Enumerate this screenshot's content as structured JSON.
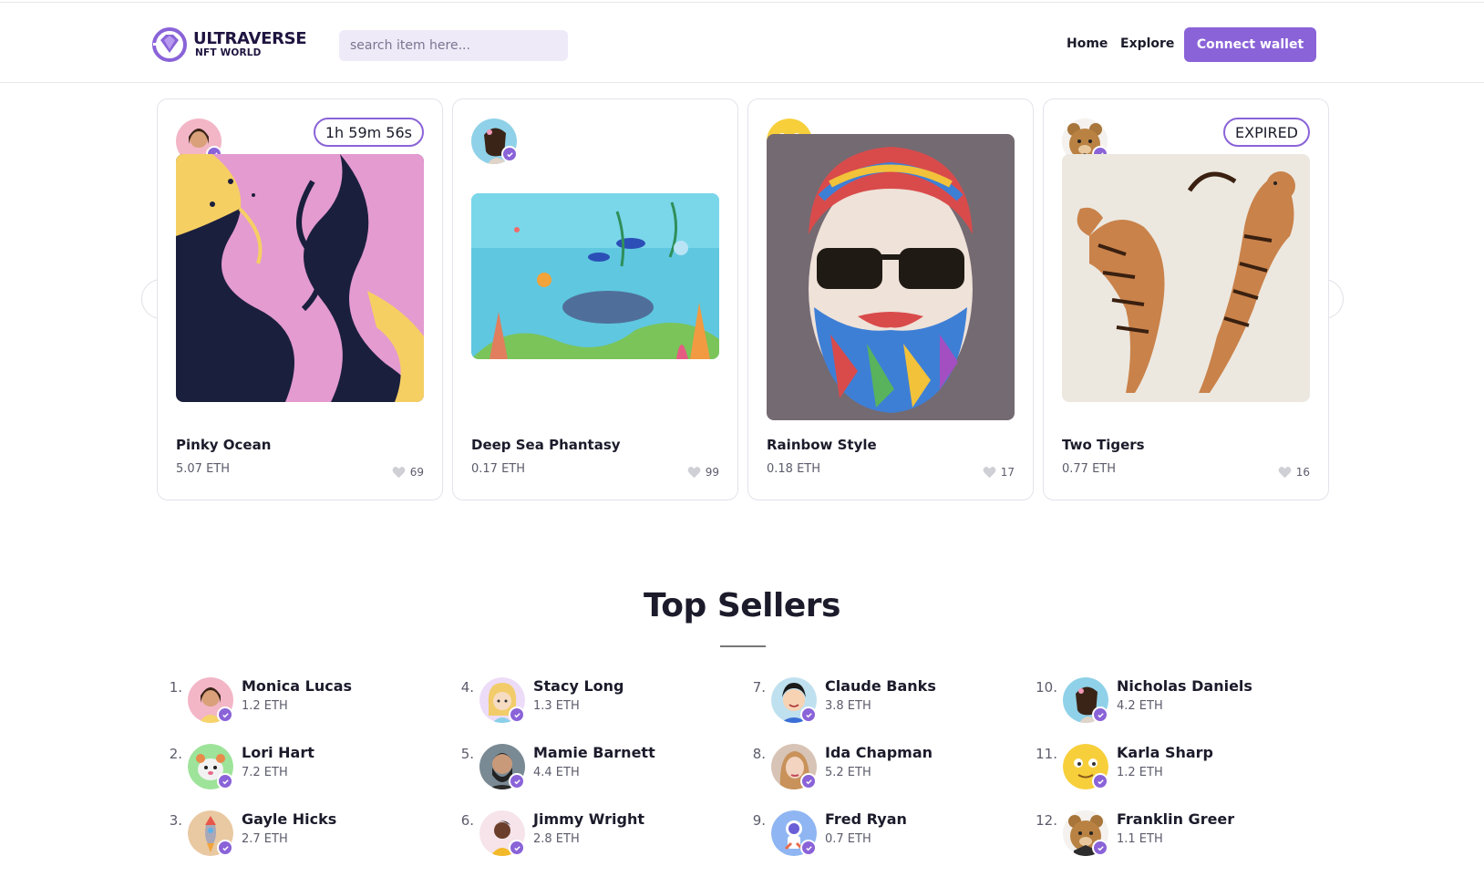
{
  "header": {
    "logo_main": "ULTRAVERSE",
    "logo_sub": "NFT WORLD",
    "search_placeholder": "search item here...",
    "nav": {
      "home": "Home",
      "explore": "Explore"
    },
    "connect_label": "Connect wallet",
    "accent": "#8a63d8"
  },
  "carousel": {
    "cards": [
      {
        "title": "Pinky Ocean",
        "price": "5.07 ETH",
        "likes": "69",
        "timer": "1h 59m 56s",
        "art_icon": "marble-art"
      },
      {
        "title": "Deep Sea Phantasy",
        "price": "0.17 ETH",
        "likes": "99",
        "timer": "",
        "art_icon": "underwater-art"
      },
      {
        "title": "Rainbow Style",
        "price": "0.18 ETH",
        "likes": "17",
        "timer": "",
        "art_icon": "bearded-man-art"
      },
      {
        "title": "Two Tigers",
        "price": "0.77 ETH",
        "likes": "16",
        "timer": "EXPIRED",
        "art_icon": "tigers-art"
      }
    ]
  },
  "top_sellers": {
    "title": "Top Sellers",
    "sellers": [
      {
        "rank": "1.",
        "name": "Monica Lucas",
        "eth": "1.2 ETH"
      },
      {
        "rank": "2.",
        "name": "Lori Hart",
        "eth": "7.2 ETH"
      },
      {
        "rank": "3.",
        "name": "Gayle Hicks",
        "eth": "2.7 ETH"
      },
      {
        "rank": "4.",
        "name": "Stacy Long",
        "eth": "1.3 ETH"
      },
      {
        "rank": "5.",
        "name": "Mamie Barnett",
        "eth": "4.4 ETH"
      },
      {
        "rank": "6.",
        "name": "Jimmy Wright",
        "eth": "2.8 ETH"
      },
      {
        "rank": "7.",
        "name": "Claude Banks",
        "eth": "3.8 ETH"
      },
      {
        "rank": "8.",
        "name": "Ida Chapman",
        "eth": "5.2 ETH"
      },
      {
        "rank": "9.",
        "name": "Fred Ryan",
        "eth": "0.7 ETH"
      },
      {
        "rank": "10.",
        "name": "Nicholas Daniels",
        "eth": "4.2 ETH"
      },
      {
        "rank": "11.",
        "name": "Karla Sharp",
        "eth": "1.2 ETH"
      },
      {
        "rank": "12.",
        "name": "Franklin Greer",
        "eth": "1.1 ETH"
      }
    ]
  }
}
